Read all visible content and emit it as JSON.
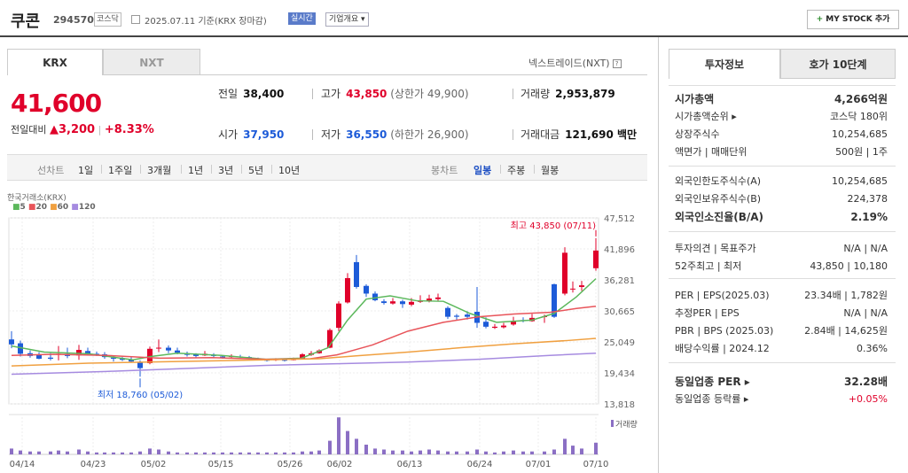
{
  "header": {
    "name": "쿠콘",
    "code": "294570",
    "market": "코스닥",
    "date": "2025.07.11  기준(KRX 장마감)",
    "realtime": "실시간",
    "corp_info": "기업개요 ▾",
    "mystock": "MY STOCK 추가"
  },
  "tabs": {
    "krx": "KRX",
    "nxt": "NXT",
    "nextrade": "넥스트레이드(NXT)"
  },
  "price": {
    "current": "41,600",
    "change_label": "전일대비",
    "change": "▲3,200",
    "rate": "+8.33%"
  },
  "stats": {
    "prev_label": "전일",
    "prev": "38,400",
    "high_label": "고가",
    "high": "43,850",
    "upper": "(상한가 49,900)",
    "vol_label": "거래량",
    "vol": "2,953,879",
    "open_label": "시가",
    "open": "37,950",
    "low_label": "저가",
    "low": "36,550",
    "lower": "(하한가 26,900)",
    "amt_label": "거래대금",
    "amt": "121,690 백만"
  },
  "periods": {
    "line": "선차트",
    "d1": "1일",
    "w1": "1주일",
    "m3": "3개월",
    "y1": "1년",
    "y3": "3년",
    "y5": "5년",
    "y10": "10년",
    "candle": "봉차트",
    "day": "일봉",
    "week": "주봉",
    "month": "월봉"
  },
  "chart_labels": {
    "source": "한국거래소(KRX)",
    "ma5": "5",
    "ma20": "20",
    "ma60": "60",
    "ma120": "120",
    "high_note": "최고 43,850 (07/11)",
    "low_note": "최저 18,760 (05/02)",
    "vol": "거래량"
  },
  "chart_data": {
    "type": "candlestick",
    "title": "",
    "y_ticks": [
      "47,512",
      "41,896",
      "36,281",
      "30,665",
      "25,049",
      "19,434",
      "13,818"
    ],
    "x_ticks": [
      "04/14",
      "04/23",
      "05/02",
      "05/15",
      "05/26",
      "06/02",
      "06/13",
      "06/24",
      "07/01",
      "07/10"
    ],
    "ylim": [
      13818,
      47512
    ],
    "series": [
      {
        "name": "5"
      },
      {
        "name": "20"
      },
      {
        "name": "60"
      },
      {
        "name": "120"
      }
    ],
    "high": {
      "value": 43850,
      "date": "07/11"
    },
    "low": {
      "value": 18760,
      "date": "05/02"
    },
    "colors": {
      "ma5": "#5cb85c",
      "ma20": "#e8545a",
      "ma60": "#f0a040",
      "ma120": "#a68be0",
      "up": "#e0002a",
      "down": "#1d5bd8",
      "vol": "#8b6fc4"
    }
  },
  "right": {
    "tab1": "투자정보",
    "tab2": "호가 10단계",
    "rows1": [
      {
        "k": "시가총액",
        "v": "4,266억원",
        "bold": true
      },
      {
        "k": "시가총액순위 ▸",
        "v": "코스닥 180위"
      },
      {
        "k": "상장주식수",
        "v": "10,254,685"
      },
      {
        "k": "액면가 | 매매단위",
        "v": "500원 | 1주"
      }
    ],
    "rows2": [
      {
        "k": "외국인한도주식수(A)",
        "v": "10,254,685"
      },
      {
        "k": "외국인보유주식수(B)",
        "v": "224,378"
      },
      {
        "k": "외국인소진율(B/A)",
        "v": "2.19%",
        "bold": true
      }
    ],
    "rows3": [
      {
        "k": "투자의견 | 목표주가",
        "v": "N/A | N/A"
      },
      {
        "k": "52주최고 | 최저",
        "v": "43,850 | 10,180"
      }
    ],
    "rows4": [
      {
        "k": "PER | EPS(2025.03)",
        "v": "23.34배 | 1,782원"
      },
      {
        "k": "추정PER | EPS",
        "v": "N/A | N/A"
      },
      {
        "k": "PBR | BPS (2025.03)",
        "v": "2.84배 | 14,625원"
      },
      {
        "k": "배당수익률 | 2024.12",
        "v": "0.36%"
      }
    ],
    "rows5": [
      {
        "k": "동일업종 PER ▸",
        "v": "32.28배",
        "bold": true
      },
      {
        "k": "동일업종 등락률 ▸",
        "v": "+0.05%",
        "red": true
      }
    ]
  }
}
